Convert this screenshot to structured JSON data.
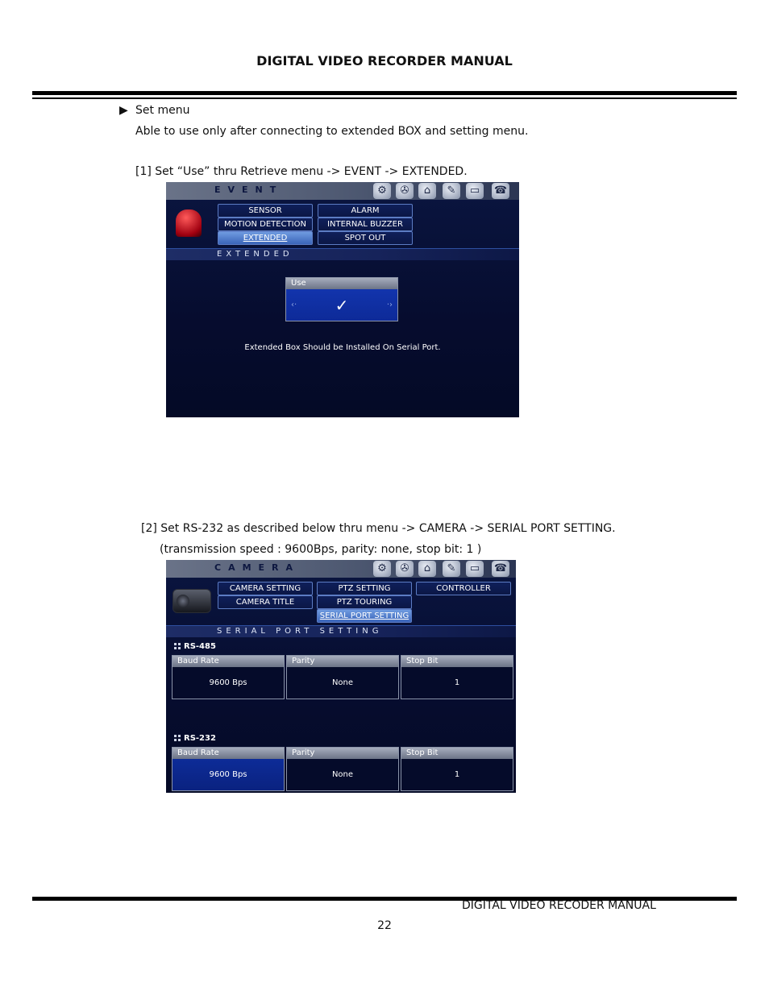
{
  "header": {
    "title": "DIGITAL VIDEO RECORDER MANUAL"
  },
  "section": {
    "bullet": "▶",
    "heading": "Set menu",
    "intro": "Able to use only after connecting to extended BOX and setting menu.",
    "step1": "[1] Set “Use” thru Retrieve menu -> EVENT -> EXTENDED.",
    "step2": "[2] Set RS-232 as described below thru menu -> CAMERA -> SERIAL PORT SETTING.",
    "step2_note": "(transmission speed : 9600Bps,   parity: none,   stop bit: 1   )"
  },
  "screen1": {
    "title": "EVENT",
    "menu": {
      "sensor": "SENSOR",
      "alarm": "ALARM",
      "motion": "MOTION DETECTION",
      "buzzer": "INTERNAL BUZZER",
      "extended": "EXTENDED",
      "spot": "SPOT OUT"
    },
    "section_title": "EXTENDED",
    "use_label": "Use",
    "use_value": "✓",
    "notice": "Extended Box Should be Installed On Serial Port."
  },
  "screen2": {
    "title": "CAMERA",
    "menu": {
      "camera_setting": "CAMERA SETTING",
      "ptz_setting": "PTZ SETTING",
      "controller": "CONTROLLER",
      "camera_title": "CAMERA TITLE",
      "ptz_touring": "PTZ TOURING",
      "serial_port": "SERIAL PORT SETTING"
    },
    "section_title": "SERIAL PORT SETTING",
    "rs485": {
      "label": "RS-485",
      "baud_label": "Baud Rate",
      "baud_value": "9600 Bps",
      "parity_label": "Parity",
      "parity_value": "None",
      "stop_label": "Stop Bit",
      "stop_value": "1"
    },
    "rs232": {
      "label": "RS-232",
      "baud_label": "Baud Rate",
      "baud_value": "9600 Bps",
      "parity_label": "Parity",
      "parity_value": "None",
      "stop_label": "Stop Bit",
      "stop_value": "1"
    }
  },
  "footer": {
    "title": "DIGITAL VIDEO RECODER MANUAL",
    "page": "22"
  }
}
